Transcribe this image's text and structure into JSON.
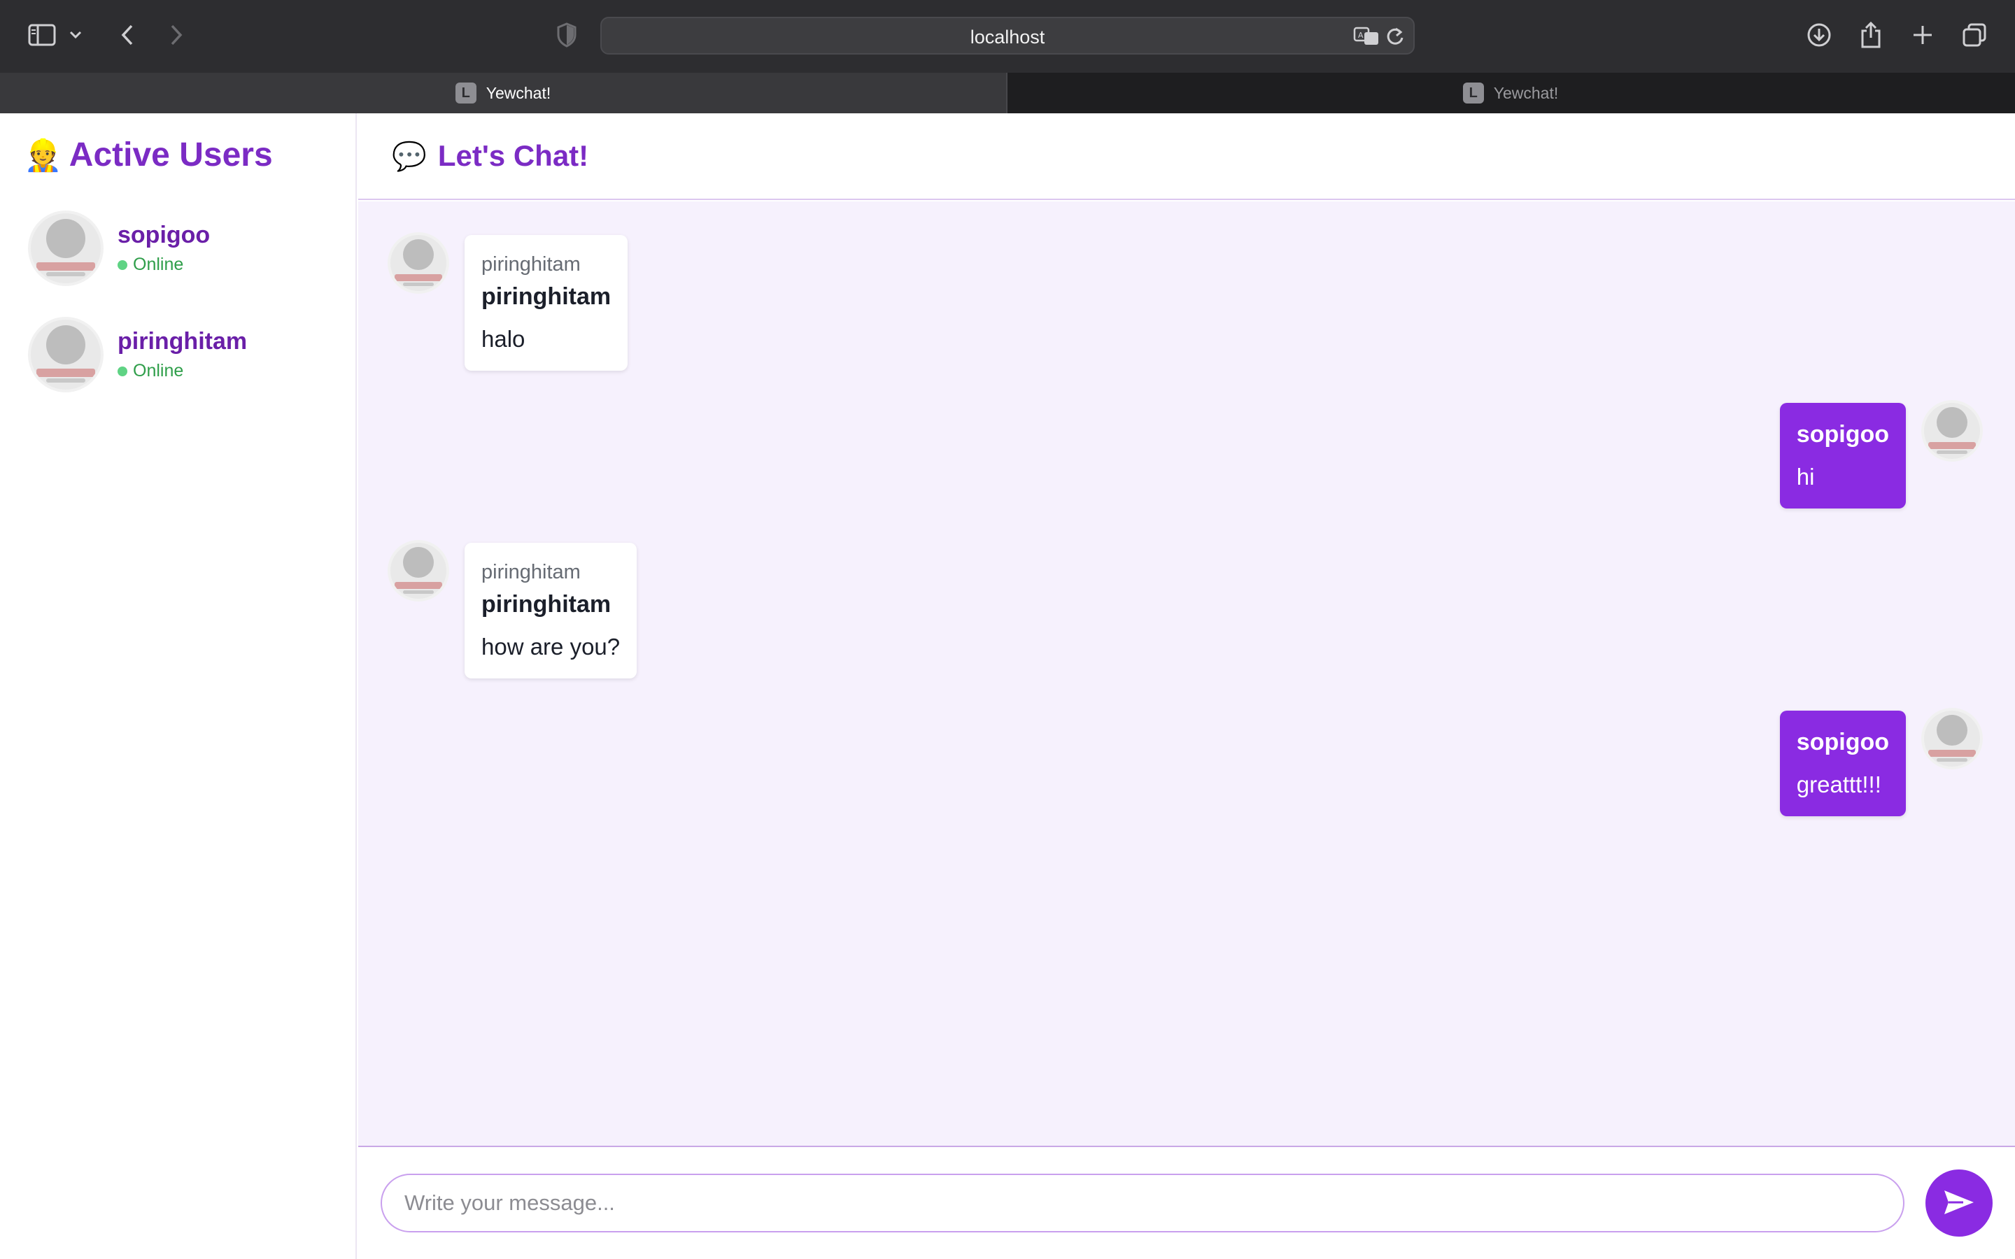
{
  "browser": {
    "url": "localhost",
    "tabs": [
      {
        "favicon": "L",
        "title": "Yewchat!",
        "active": true
      },
      {
        "favicon": "L",
        "title": "Yewchat!",
        "active": false
      }
    ],
    "icons": [
      "sidebar-toggle-icon",
      "chevron-down-icon",
      "back-arrow-icon",
      "forward-arrow-icon",
      "privacy-shield-icon",
      "translate-icon",
      "reload-icon",
      "download-icon",
      "share-icon",
      "new-tab-icon",
      "tab-overview-icon"
    ]
  },
  "sidebar": {
    "emoji": "👷",
    "title": "Active Users",
    "users": [
      {
        "name": "sopigoo",
        "status": "Online"
      },
      {
        "name": "piringhitam",
        "status": "Online"
      }
    ]
  },
  "chat": {
    "emoji": "💬",
    "title": "Let's Chat!",
    "messages": [
      {
        "direction": "incoming",
        "from": "piringhitam",
        "sender": "piringhitam",
        "text": "halo"
      },
      {
        "direction": "outgoing",
        "sender": "sopigoo",
        "text": "hi"
      },
      {
        "direction": "incoming",
        "from": "piringhitam",
        "sender": "piringhitam",
        "text": "how are you?"
      },
      {
        "direction": "outgoing",
        "sender": "sopigoo",
        "text": "greattt!!!"
      }
    ]
  },
  "composer": {
    "placeholder": "Write your message...",
    "value": "",
    "send_icon": "send-icon"
  },
  "colors": {
    "accent": "#8a2be2",
    "title": "#7b2bc4",
    "chat_bg": "#f6f1fd",
    "online": "#5fd384"
  }
}
